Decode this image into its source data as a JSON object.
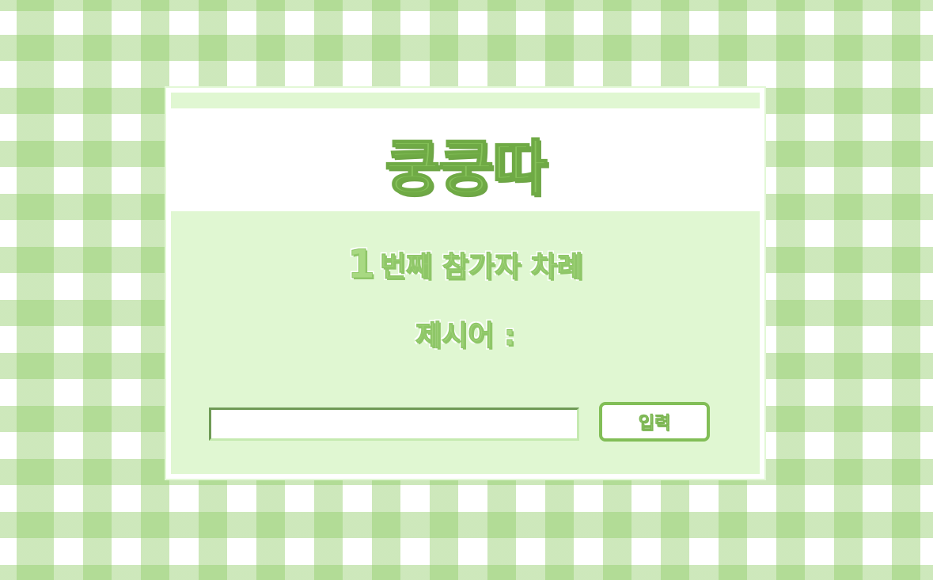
{
  "game": {
    "title": "쿵쿵따"
  },
  "turn": {
    "number": "1",
    "label": "번째 참가자 차례"
  },
  "prompt": {
    "label": "제시어 :"
  },
  "input": {
    "value": "",
    "placeholder": ""
  },
  "submit": {
    "label": "입력"
  },
  "colors": {
    "accent": "#86c25a",
    "panel_background": "#e0f7d2",
    "pattern": "#91cd69"
  }
}
